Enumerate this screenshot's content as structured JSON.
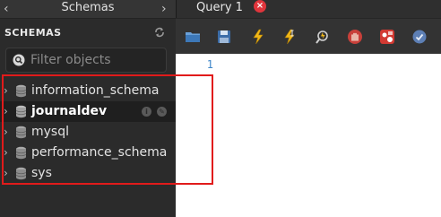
{
  "schemas_panel": {
    "tab_title": "Schemas",
    "header": "SCHEMAS",
    "filter": {
      "placeholder": "Filter objects",
      "value": ""
    },
    "schemas": [
      {
        "name": "information_schema",
        "selected": false
      },
      {
        "name": "journaldev",
        "selected": true
      },
      {
        "name": "mysql",
        "selected": false
      },
      {
        "name": "performance_schema",
        "selected": false
      },
      {
        "name": "sys",
        "selected": false
      }
    ]
  },
  "editor_tabs": [
    {
      "label": "Query 1",
      "active": true
    }
  ],
  "toolbar_icons": [
    "open-sql-file-icon",
    "save-icon",
    "execute-icon",
    "execute-current-statement-icon",
    "explain-icon",
    "stop-icon",
    "toggle-error-continue-icon",
    "commit-icon"
  ],
  "editor": {
    "line_numbers": [
      "1"
    ]
  },
  "colors": {
    "highlight_box": "#e11b1b",
    "close_button": "#e0353c",
    "line_number": "#3f87c9",
    "panel_background": "#2b2b2b",
    "editor_background": "#ffffff"
  }
}
